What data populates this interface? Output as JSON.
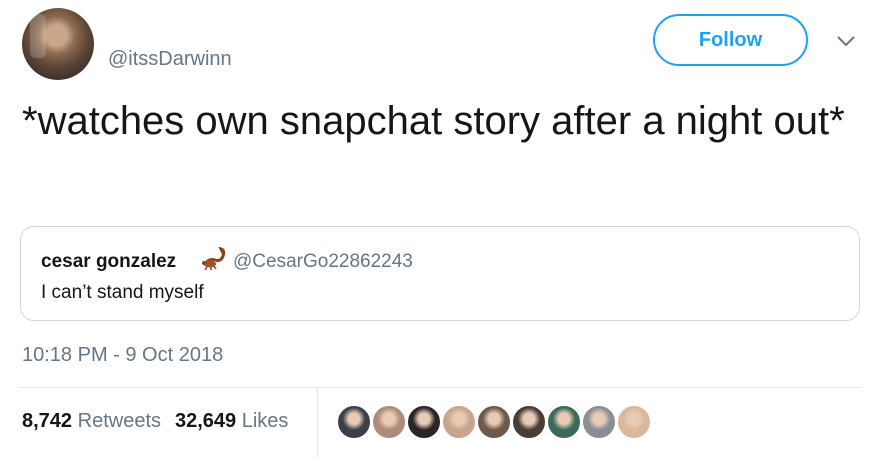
{
  "author": {
    "handle": "@itssDarwinn",
    "avatar_icon": "profile-photo"
  },
  "follow_label": "Follow",
  "tweet_text": "*watches own snapchat story after a night out*",
  "quoted": {
    "name": "cesar gonzalez",
    "emoji_icon": "scorpion-emoji",
    "handle": "@CesarGo22862243",
    "text": "I can’t stand myself"
  },
  "timestamp": "10:18 PM - 9 Oct 2018",
  "stats": {
    "retweets_count": "8,742",
    "retweets_label": "Retweets",
    "likes_count": "32,649",
    "likes_label": "Likes"
  },
  "colors": {
    "accent": "#1da1f2",
    "secondary_text": "#657786",
    "border": "#ccd6dd"
  },
  "liker_avatars": [
    {
      "color": "#3b3f4a"
    },
    {
      "color": "#b08a7a"
    },
    {
      "color": "#2b2528"
    },
    {
      "color": "#c9a48e"
    },
    {
      "color": "#6e5a4c"
    },
    {
      "color": "#4a3c36"
    },
    {
      "color": "#3c6a5a"
    },
    {
      "color": "#8a8f96"
    },
    {
      "color": "#d9b89c"
    }
  ]
}
